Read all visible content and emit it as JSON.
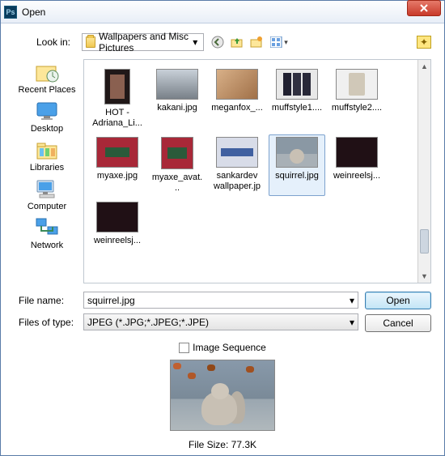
{
  "title": "Open",
  "look_in": {
    "label": "Look in:",
    "value": "Wallpapers and Misc Pictures"
  },
  "places": {
    "recent": "Recent Places",
    "desktop": "Desktop",
    "libraries": "Libraries",
    "computer": "Computer",
    "network": "Network"
  },
  "files": {
    "f0": "HOT - Adriana_Li...",
    "f1": "kakani.jpg",
    "f2": "meganfox_...",
    "f3": "muffstyle1....",
    "f4": "muffstyle2....",
    "f5": "myaxe.jpg",
    "f6": "myaxe_avat...",
    "f7": "sankardev wallpaper.jpg",
    "f8": "squirrel.jpg",
    "f9": "weinreelsj...",
    "f10": "weinreelsj..."
  },
  "filename": {
    "label": "File name:",
    "value": "squirrel.jpg"
  },
  "filetype": {
    "label": "Files of type:",
    "value": "JPEG (*.JPG;*.JPEG;*.JPE)"
  },
  "buttons": {
    "open": "Open",
    "cancel": "Cancel"
  },
  "sequence": "Image Sequence",
  "filesize": "File Size: 77.3K",
  "icons": {
    "ps": "Ps",
    "back": "back-icon",
    "up": "up-icon",
    "newfolder": "new-folder-icon",
    "views": "views-icon",
    "fav": "fav-icon"
  }
}
